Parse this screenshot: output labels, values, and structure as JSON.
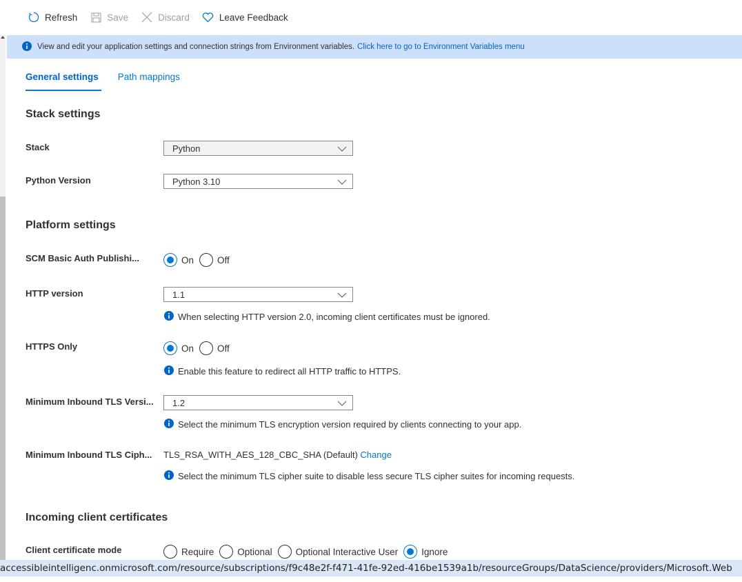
{
  "toolbar": {
    "refresh": "Refresh",
    "save": "Save",
    "discard": "Discard",
    "feedback": "Leave Feedback"
  },
  "banner": {
    "text": "View and edit your application settings and connection strings from Environment variables.",
    "link": "Click here to go to Environment Variables menu"
  },
  "tabs": [
    {
      "label": "General settings",
      "active": true
    },
    {
      "label": "Path mappings",
      "active": false
    }
  ],
  "stack_settings": {
    "title": "Stack settings",
    "stack_label": "Stack",
    "stack_value": "Python",
    "python_version_label": "Python Version",
    "python_version_value": "Python 3.10"
  },
  "platform_settings": {
    "title": "Platform settings",
    "scm_label": "SCM Basic Auth Publishi...",
    "scm_options": [
      "On",
      "Off"
    ],
    "scm_selected": "On",
    "http_version_label": "HTTP version",
    "http_version_value": "1.1",
    "http_version_hint": "When selecting HTTP version 2.0, incoming client certificates must be ignored.",
    "https_only_label": "HTTPS Only",
    "https_only_options": [
      "On",
      "Off"
    ],
    "https_only_selected": "On",
    "https_only_hint": "Enable this feature to redirect all HTTP traffic to HTTPS.",
    "min_tls_label": "Minimum Inbound TLS Versi...",
    "min_tls_value": "1.2",
    "min_tls_hint": "Select the minimum TLS encryption version required by clients connecting to your app.",
    "min_cipher_label": "Minimum Inbound TLS Ciph...",
    "min_cipher_value": "TLS_RSA_WITH_AES_128_CBC_SHA (Default)",
    "min_cipher_change": "Change",
    "min_cipher_hint": "Select the minimum TLS cipher suite to disable less secure TLS cipher suites for incoming requests."
  },
  "client_certs": {
    "title": "Incoming client certificates",
    "mode_label": "Client certificate mode",
    "mode_options": [
      "Require",
      "Optional",
      "Optional Interactive User",
      "Ignore"
    ],
    "mode_selected": "Ignore"
  },
  "statusbar": {
    "url": "accessibleintelligenc.onmicrosoft.com/resource/subscriptions/f9c48e2f-f471-41fe-92ed-416be1539a1b/resourceGroups/DataScience/providers/Microsoft.Web"
  },
  "colors": {
    "accent": "#0078d4",
    "banner_bg": "#cce0fb",
    "statusbar_bg": "#dbe6f6"
  }
}
